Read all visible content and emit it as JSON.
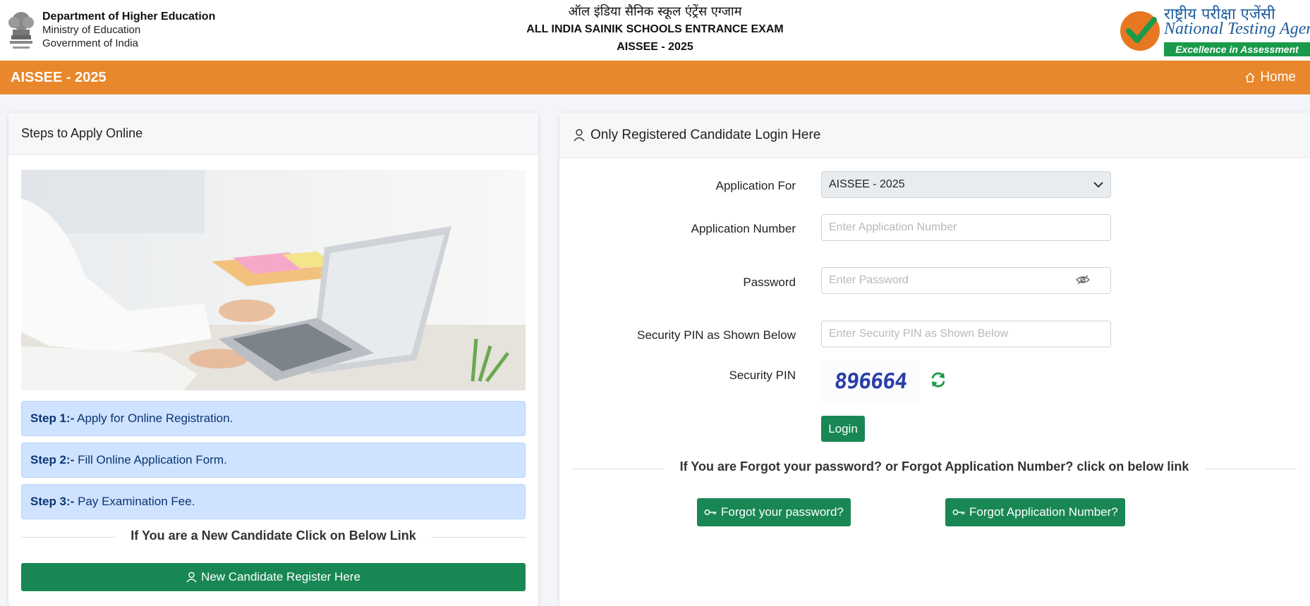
{
  "header": {
    "dept_line1": "Department of Higher Education",
    "dept_line2": "Ministry of Education",
    "dept_line3": "Government of India",
    "title_hindi": "ऑल इंडिया सैनिक स्कूल एंट्रेंस एग्जाम",
    "title_english": "ALL INDIA SAINIK SCHOOLS ENTRANCE EXAM",
    "title_year": "AISSEE - 2025",
    "nta_hindi": "राष्ट्रीय परीक्षा एजेंसी",
    "nta_name": "National Testing Agency",
    "nta_tagline": "Excellence in Assessment"
  },
  "navbar": {
    "brand": "AISSEE - 2025",
    "home_label": "Home",
    "accent_color": "#e8872b"
  },
  "left_panel": {
    "heading": "Steps to Apply Online",
    "steps": [
      {
        "label": "Step 1:-",
        "text": "Apply for Online Registration."
      },
      {
        "label": "Step 2:-",
        "text": "Fill Online Application Form."
      },
      {
        "label": "Step 3:-",
        "text": "Pay Examination Fee."
      }
    ],
    "new_candidate_text": "If You are a New Candidate Click on Below Link",
    "register_button": "New Candidate Register Here"
  },
  "login_panel": {
    "heading": "Only Registered Candidate Login Here",
    "application_for_label": "Application For",
    "application_for_value": "AISSEE - 2025",
    "application_number_label": "Application Number",
    "application_number_placeholder": "Enter Application Number",
    "password_label": "Password",
    "password_placeholder": "Enter Password",
    "security_pin_input_label": "Security PIN as Shown Below",
    "security_pin_input_placeholder": "Enter Security PIN as Shown Below",
    "security_pin_label": "Security PIN",
    "captcha_value": "896664",
    "login_button": "Login",
    "forgot_text": "If You are Forgot your password? or Forgot Application Number? click on below link",
    "forgot_password_button": "Forgot your password?",
    "forgot_appno_button": "Forgot Application Number?",
    "button_color": "#198754"
  }
}
